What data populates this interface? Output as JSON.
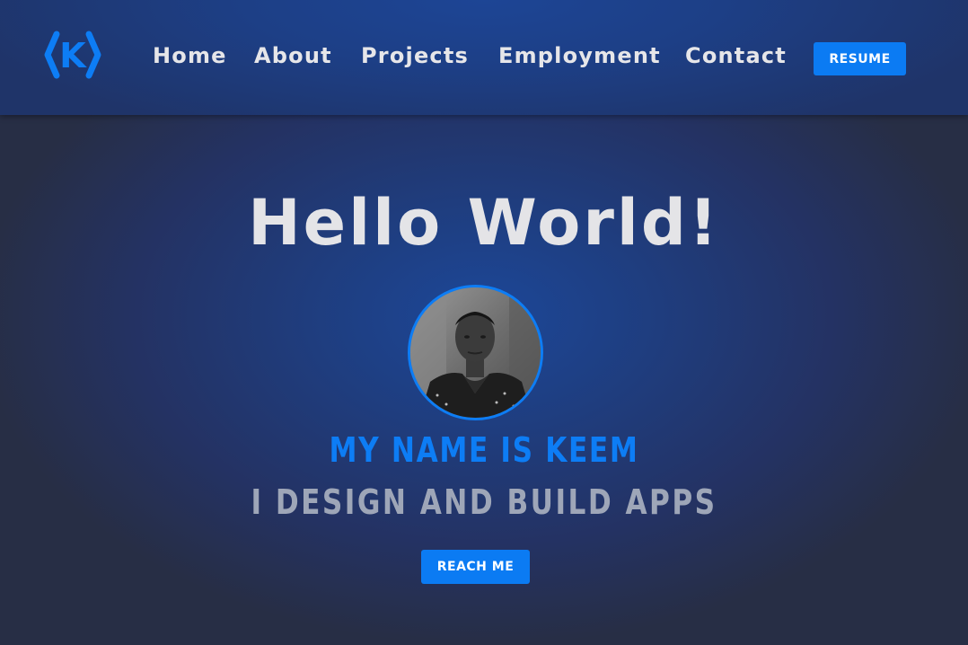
{
  "nav": {
    "logo_letter": "K",
    "links": [
      {
        "label": "Home"
      },
      {
        "label": "About"
      },
      {
        "label": "Projects"
      },
      {
        "label": "Employment"
      },
      {
        "label": "Contact"
      }
    ],
    "resume_label": "RESUME"
  },
  "hero": {
    "title": "Hello World!",
    "name_line": "MY NAME IS KEEM",
    "tagline": "I DESIGN AND BUILD APPS",
    "cta_label": "REACH ME"
  },
  "colors": {
    "accent": "#0b7bf3",
    "nav_text": "#e6e6e9",
    "tagline": "#9ea6b8",
    "background_dark": "#262d3d"
  },
  "icons": {
    "logo": "code-brackets-k-logo"
  }
}
